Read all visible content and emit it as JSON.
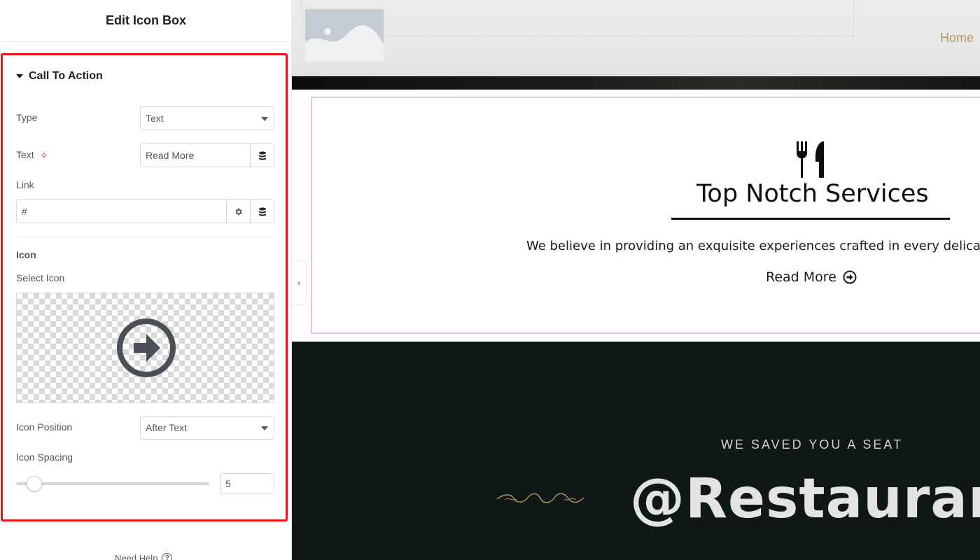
{
  "panel": {
    "title": "Edit Icon Box",
    "section_title": "Call To Action",
    "type": {
      "label": "Type",
      "value": "Text"
    },
    "text": {
      "label": "Text",
      "value": "Read More",
      "ai_icon": "sparkle-icon"
    },
    "link": {
      "label": "Link",
      "value": "#"
    },
    "icon_heading": "Icon",
    "select_icon": {
      "label": "Select Icon",
      "icon": "circle-arrow-right-icon"
    },
    "icon_position": {
      "label": "Icon Position",
      "value": "After Text"
    },
    "icon_spacing": {
      "label": "Icon Spacing",
      "value": "5"
    },
    "need_help": "Need Help",
    "highlight_color": "#e8141b"
  },
  "preview": {
    "nav_home": "Home",
    "icon_box": {
      "icon": "utensils-icon",
      "title": "Top Notch Services",
      "description": "We believe in providing an exquisite experiences crafted in every delicacy",
      "cta_text": "Read More",
      "cta_icon": "circle-arrow-right-icon"
    },
    "section_tag": "WE SAVED YOU A SEAT",
    "section_heading": "@Restaurant",
    "accent_color": "#b39762"
  }
}
